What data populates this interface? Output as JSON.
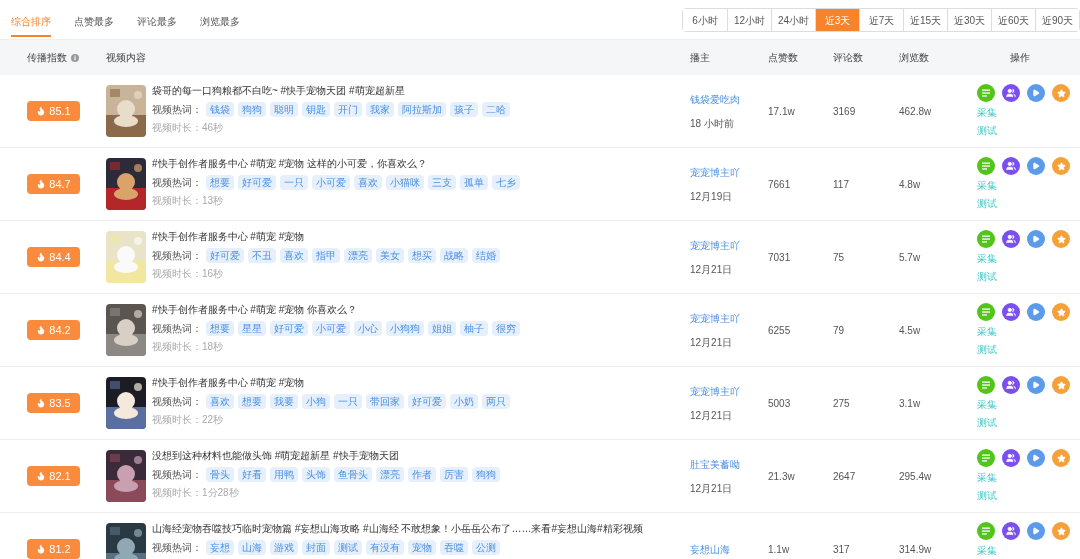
{
  "sort_tabs": [
    {
      "label": "综合排序",
      "selected": true
    },
    {
      "label": "点赞最多",
      "selected": false
    },
    {
      "label": "评论最多",
      "selected": false
    },
    {
      "label": "浏览最多",
      "selected": false
    }
  ],
  "time_filters": [
    {
      "label": "6小时",
      "selected": false
    },
    {
      "label": "12小时",
      "selected": false
    },
    {
      "label": "24小时",
      "selected": false
    },
    {
      "label": "近3天",
      "selected": true
    },
    {
      "label": "近7天",
      "selected": false
    },
    {
      "label": "近15天",
      "selected": false
    },
    {
      "label": "近30天",
      "selected": false
    },
    {
      "label": "近60天",
      "selected": false
    },
    {
      "label": "近90天",
      "selected": false
    }
  ],
  "columns": [
    "传播指数",
    "视频内容",
    "播主",
    "点赞数",
    "评论数",
    "浏览数",
    "操作"
  ],
  "rows": [
    {
      "score": "85.1",
      "title": "袋哥的每一口狗粮都不白吃~ #快手宠物天团 #萌宠超新星",
      "tags_label": "视频热词：",
      "tags": [
        "钱袋",
        "狗狗",
        "聪明",
        "钥匙",
        "开门",
        "我家",
        "阿拉斯加",
        "孩子",
        "二哈"
      ],
      "duration": "视频时长：46秒",
      "author": "钱袋爱吃肉",
      "date": "18 小时前",
      "likes": "17.1w",
      "comments": "3169",
      "views": "462.8w",
      "actions": [
        "采集",
        "测试"
      ]
    },
    {
      "score": "84.7",
      "title": "#快手创作者服务中心 #萌宠 #宠物 这样的小可爱，你喜欢么？",
      "tags_label": "视频热词：",
      "tags": [
        "想要",
        "好可爱",
        "一只",
        "小可爱",
        "喜欢",
        "小猫咪",
        "三支",
        "孤单",
        "七乡"
      ],
      "duration": "视频时长：13秒",
      "author": "宠宠博主吖",
      "date": "12月19日",
      "likes": "7661",
      "comments": "117",
      "views": "4.8w",
      "actions": [
        "采集",
        "测试"
      ]
    },
    {
      "score": "84.4",
      "title": "#快手创作者服务中心 #萌宠 #宠物",
      "tags_label": "视频热词：",
      "tags": [
        "好可爱",
        "不丑",
        "喜欢",
        "指甲",
        "漂亮",
        "美女",
        "想买",
        "战略",
        "结婚"
      ],
      "duration": "视频时长：16秒",
      "author": "宠宠博主吖",
      "date": "12月21日",
      "likes": "7031",
      "comments": "75",
      "views": "5.7w",
      "actions": [
        "采集",
        "测试"
      ]
    },
    {
      "score": "84.2",
      "title": "#快手创作者服务中心 #萌宠 #宠物 你喜欢么？",
      "tags_label": "视频热词：",
      "tags": [
        "想要",
        "星星",
        "好可爱",
        "小可爱",
        "小心",
        "小狗狗",
        "姐姐",
        "柚子",
        "很穷"
      ],
      "duration": "视频时长：18秒",
      "author": "宠宠博主吖",
      "date": "12月21日",
      "likes": "6255",
      "comments": "79",
      "views": "4.5w",
      "actions": [
        "采集",
        "测试"
      ]
    },
    {
      "score": "83.5",
      "title": "#快手创作者服务中心 #萌宠 #宠物",
      "tags_label": "视频热词：",
      "tags": [
        "喜欢",
        "想要",
        "我要",
        "小狗",
        "一只",
        "带回家",
        "好可爱",
        "小奶",
        "两只"
      ],
      "duration": "视频时长：22秒",
      "author": "宠宠博主吖",
      "date": "12月21日",
      "likes": "5003",
      "comments": "275",
      "views": "3.1w",
      "actions": [
        "采集",
        "测试"
      ]
    },
    {
      "score": "82.1",
      "title": "没想到这种材料也能做头饰 #萌宠超新星 #快手宠物天团",
      "tags_label": "视频热词：",
      "tags": [
        "骨头",
        "好看",
        "用鸭",
        "头饰",
        "鱼骨头",
        "漂亮",
        "作者",
        "厉害",
        "狗狗"
      ],
      "duration": "视频时长：1分28秒",
      "author": "肚宝美蓄呦",
      "date": "12月21日",
      "likes": "21.3w",
      "comments": "2647",
      "views": "295.4w",
      "actions": [
        "采集",
        "测试"
      ]
    },
    {
      "score": "81.2",
      "title": "山海经宠物吞噬技巧临时宠物篇 #妄想山海攻略 #山海经 不敢想象！小岳岳公布了……来看#妄想山海#精彩视频",
      "tags_label": "视频热词：",
      "tags": [
        "妄想",
        "山海",
        "游戏",
        "封面",
        "测试",
        "有没有",
        "宠物",
        "吞噬",
        "公测"
      ],
      "author": "妄想山海",
      "likes": "1.1w",
      "comments": "317",
      "views": "314.9w",
      "actions": [
        "采集"
      ]
    }
  ]
}
